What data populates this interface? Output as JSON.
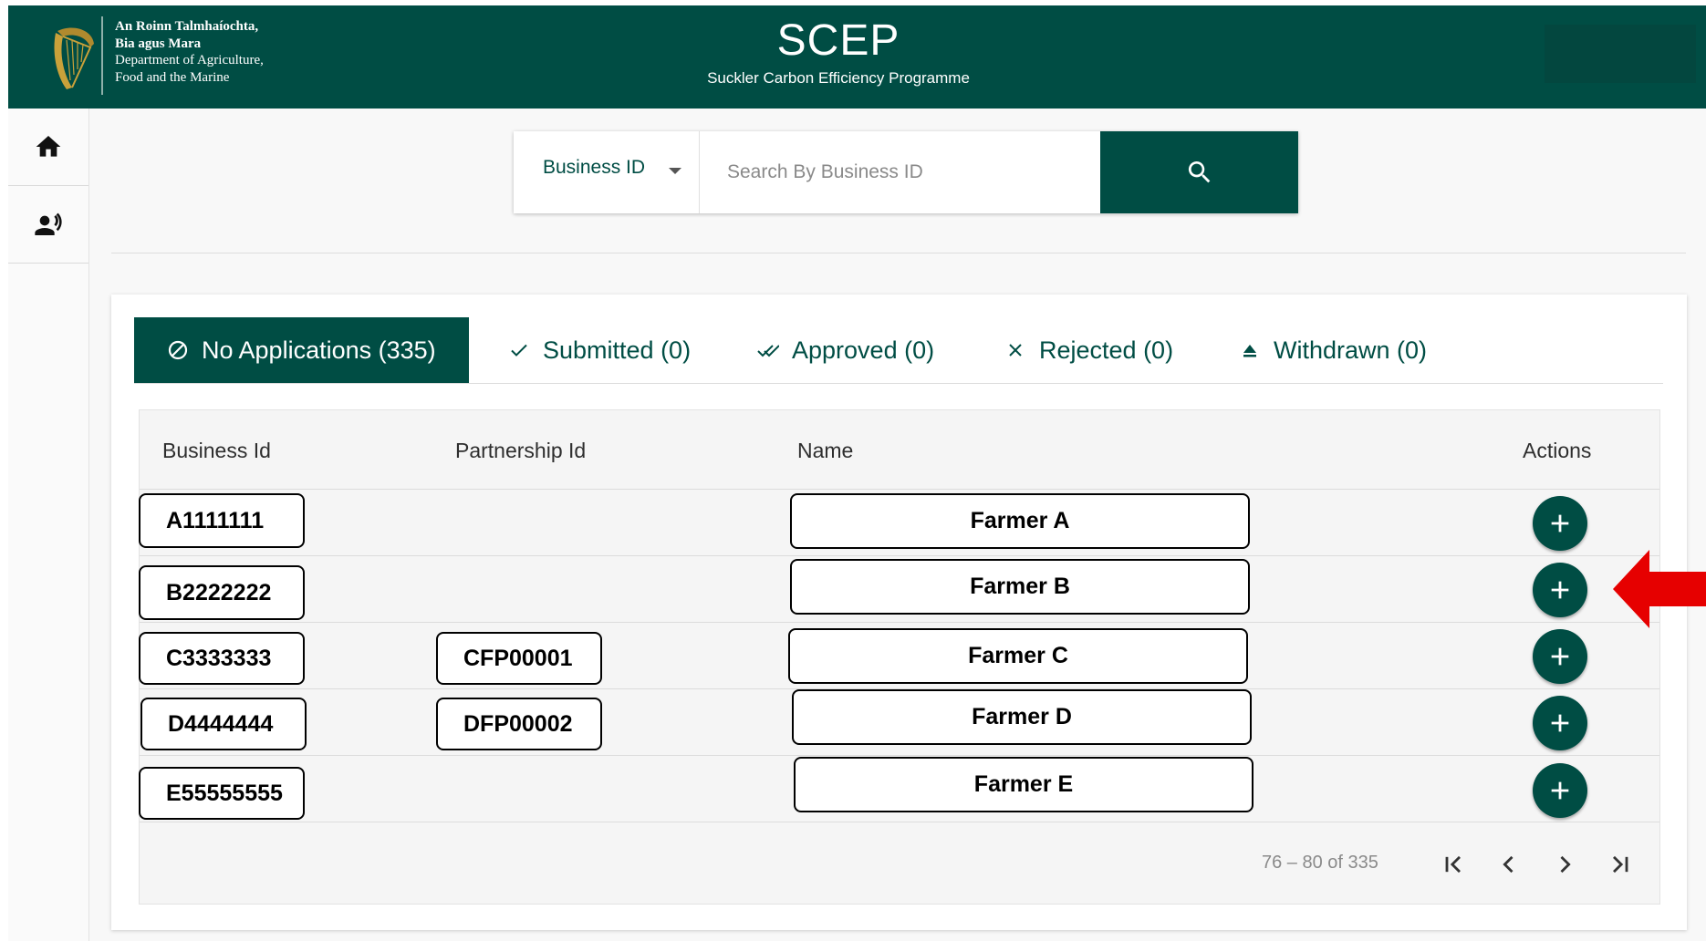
{
  "header": {
    "dept_lines": [
      "An Roinn Talmhaíochta,",
      "Bia agus Mara",
      "Department of Agriculture,",
      "Food and the Marine"
    ],
    "app_title": "SCEP",
    "app_subtitle": "Suckler Carbon Efficiency Programme"
  },
  "sidebar": {
    "items": [
      {
        "name": "home",
        "icon": "home-icon"
      },
      {
        "name": "speaker",
        "icon": "record-voice-icon"
      }
    ]
  },
  "search": {
    "select_label": "Business ID",
    "placeholder": "Search By Business ID",
    "value": "",
    "button_icon": "search-icon"
  },
  "tabs": [
    {
      "label": "No Applications (335)",
      "icon": "block-icon",
      "active": true
    },
    {
      "label": "Submitted (0)",
      "icon": "check-icon",
      "active": false
    },
    {
      "label": "Approved (0)",
      "icon": "double-check-icon",
      "active": false
    },
    {
      "label": "Rejected (0)",
      "icon": "close-icon",
      "active": false
    },
    {
      "label": "Withdrawn (0)",
      "icon": "eject-icon",
      "active": false
    }
  ],
  "table": {
    "columns": [
      "Business Id",
      "Partnership Id",
      "Name",
      "Actions"
    ],
    "rows": [
      {
        "business_id": "A1111111",
        "partnership_id": "",
        "name": "Farmer A"
      },
      {
        "business_id": "B2222222",
        "partnership_id": "",
        "name": "Farmer B"
      },
      {
        "business_id": "C3333333",
        "partnership_id": "CFP00001",
        "name": "Farmer C"
      },
      {
        "business_id": "D4444444",
        "partnership_id": "DFP00002",
        "name": "Farmer D"
      },
      {
        "business_id": "E55555555",
        "partnership_id": "",
        "name": "Farmer E"
      }
    ]
  },
  "pagination": {
    "range_label": "76 – 80 of 335"
  },
  "colors": {
    "brand": "#004d44",
    "annotation_arrow": "#e60000"
  }
}
